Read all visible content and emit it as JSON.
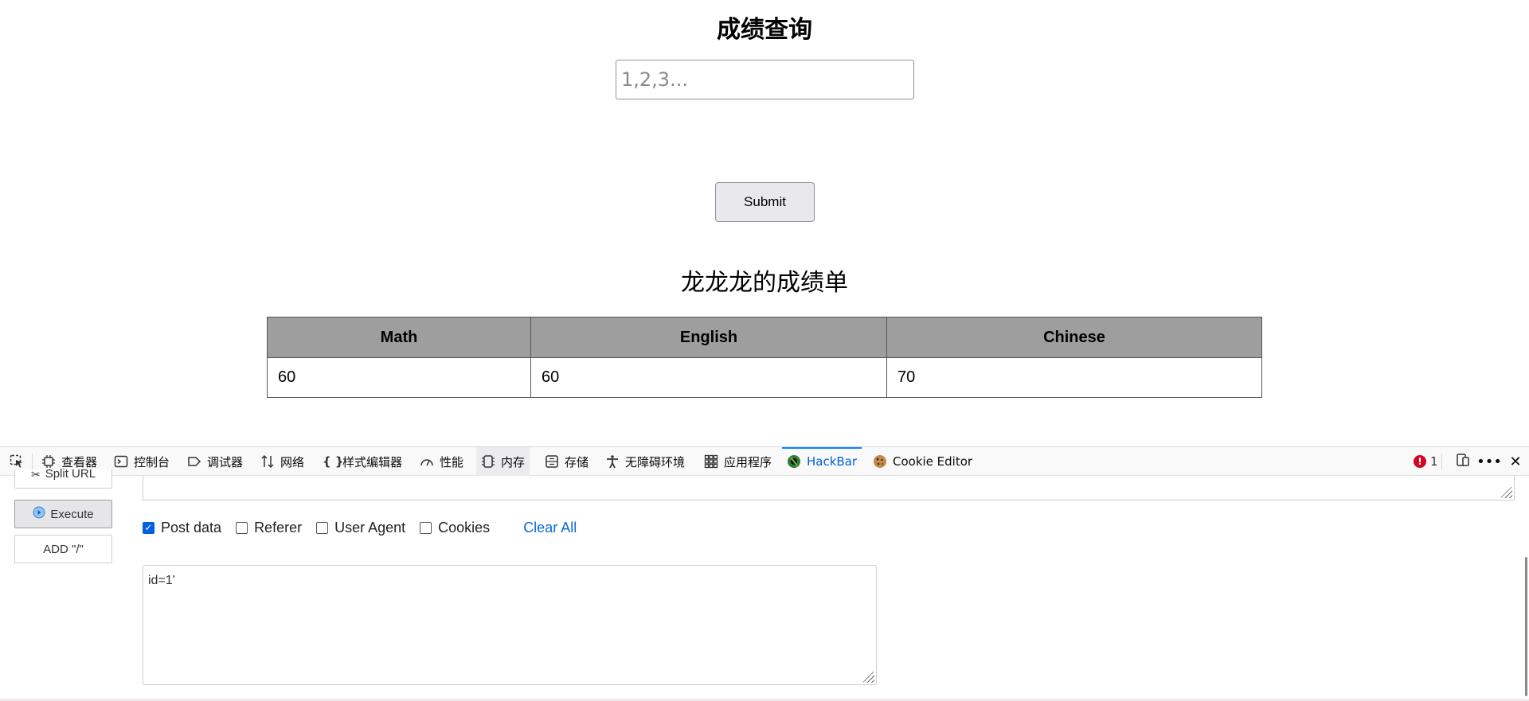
{
  "page": {
    "title": "成绩查询",
    "input_placeholder": "1,2,3...",
    "submit_label": "Submit",
    "report_title": "龙龙龙的成绩单",
    "table": {
      "headers": [
        "Math",
        "English",
        "Chinese"
      ],
      "rows": [
        [
          "60",
          "60",
          "70"
        ]
      ]
    }
  },
  "devtools": {
    "tabs": [
      {
        "label": "查看器",
        "icon": "inspector-icon"
      },
      {
        "label": "控制台",
        "icon": "console-icon"
      },
      {
        "label": "调试器",
        "icon": "debugger-icon"
      },
      {
        "label": "网络",
        "icon": "network-icon"
      },
      {
        "label": "样式编辑器",
        "icon": "style-editor-icon"
      },
      {
        "label": "性能",
        "icon": "performance-icon"
      },
      {
        "label": "内存",
        "icon": "memory-icon"
      },
      {
        "label": "存储",
        "icon": "storage-icon"
      },
      {
        "label": "无障碍环境",
        "icon": "accessibility-icon"
      },
      {
        "label": "应用程序",
        "icon": "application-icon"
      },
      {
        "label": "HackBar",
        "icon": "hackbar-icon"
      },
      {
        "label": "Cookie Editor",
        "icon": "cookie-icon"
      }
    ],
    "error_count": "1",
    "accent_color": "#0a84ff"
  },
  "hackbar": {
    "split_url_label": "Split URL",
    "execute_label": "Execute",
    "add_slash_label": "ADD \"/\"",
    "options": [
      {
        "label": "Post data",
        "checked": true
      },
      {
        "label": "Referer",
        "checked": false
      },
      {
        "label": "User Agent",
        "checked": false
      },
      {
        "label": "Cookies",
        "checked": false
      }
    ],
    "clear_all_label": "Clear All",
    "post_data_value": "id=1'"
  }
}
